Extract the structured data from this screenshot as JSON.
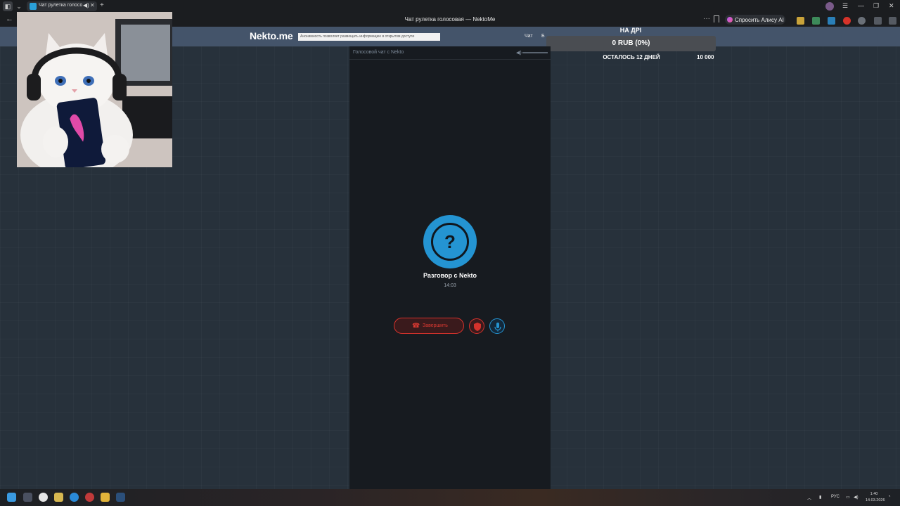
{
  "browser": {
    "tab_title": "Чат рулетка голосова",
    "tab_close": "✕",
    "audio_icon": "◀)",
    "new_tab": "+",
    "page_title": "Чат рулетка голосовая — NektoMe",
    "alice_button": "Спросить Алису AI",
    "menu_dots": "···",
    "window_controls": [
      "☰",
      "—",
      "❐",
      "✕"
    ]
  },
  "site": {
    "logo": "Nekto.me",
    "notice": "Анонимность позволяет размещать информацию в открытом доступе",
    "nav_chat": "Чат",
    "nav_more": "Б"
  },
  "donation": {
    "title": "НА ДРІ",
    "amount": "0 RUB (0%)",
    "min": "0",
    "days_left": "ОСТАЛОСЬ 12 ДНЕЙ",
    "max": "10 000"
  },
  "chat": {
    "header_label": "Голосовой чат с Nekto",
    "avatar_symbol": "?",
    "conversation_title": "Разговор с Nekto",
    "timer": "14:03",
    "end_button": "Завершить",
    "accent_blue": "#2494d2",
    "accent_red": "#d4322c"
  },
  "taskbar": {
    "lang": "РУС",
    "time": "1:40",
    "date": "14.03.2026",
    "up_arrow": "︿"
  }
}
